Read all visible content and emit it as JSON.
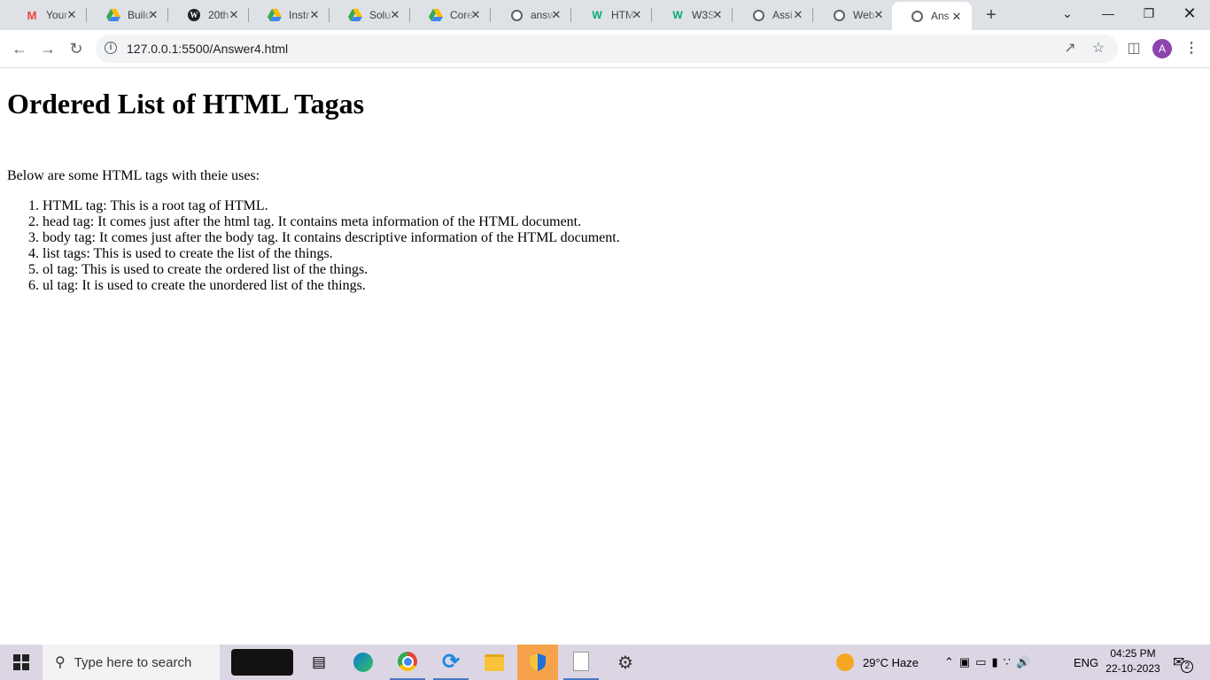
{
  "browser": {
    "tabs": [
      {
        "title": "Your",
        "icon": "gmail-icon",
        "color": "#ea4335"
      },
      {
        "title": "Build",
        "icon": "drive-icon",
        "color": "#1a73e8"
      },
      {
        "title": "20th",
        "icon": "wordpress-icon",
        "color": "#222"
      },
      {
        "title": "Instr",
        "icon": "drive-icon",
        "color": "#1a73e8"
      },
      {
        "title": "Solu",
        "icon": "drive-icon",
        "color": "#1a73e8"
      },
      {
        "title": "Core",
        "icon": "drive-icon",
        "color": "#1a73e8"
      },
      {
        "title": "answ",
        "icon": "globe-icon",
        "color": "#5f6368"
      },
      {
        "title": "HTM",
        "icon": "w3schools-icon",
        "color": "#04aa6d"
      },
      {
        "title": "W3S",
        "icon": "w3schools-icon",
        "color": "#04aa6d"
      },
      {
        "title": "Assi",
        "icon": "globe-icon",
        "color": "#5f6368"
      },
      {
        "title": "Web",
        "icon": "globe-icon",
        "color": "#5f6368"
      },
      {
        "title": "Ans",
        "icon": "globe-icon",
        "color": "#5f6368",
        "active": true
      }
    ],
    "url": "127.0.0.1:5500/Answer4.html",
    "profile_initial": "A"
  },
  "page": {
    "heading": "Ordered List of HTML Tagas",
    "intro": "Below are some HTML tags with theie uses:",
    "items": [
      "HTML tag: This is a root tag of HTML.",
      "head tag: It comes just after the html tag. It contains meta information of the HTML document.",
      "body tag: It comes just after the body tag. It contains descriptive information of the HTML document.",
      "list tags: This is used to create the list of the things.",
      "ol tag: This is used to create the ordered list of the things.",
      "ul tag: It is used to create the unordered list of the things."
    ]
  },
  "taskbar": {
    "search_placeholder": "Type here to search",
    "weather": "29°C  Haze",
    "language": "ENG",
    "time": "04:25 PM",
    "date": "22-10-2023",
    "notification_count": "2"
  }
}
